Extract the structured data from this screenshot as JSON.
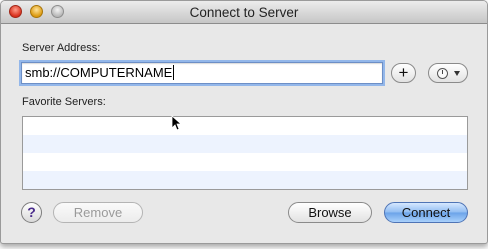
{
  "window": {
    "title": "Connect to Server"
  },
  "server_address": {
    "label": "Server Address:",
    "value": "smb://COMPUTERNAME"
  },
  "buttons": {
    "add": "+",
    "recent_icon": "clock-icon",
    "help": "?",
    "remove": "Remove",
    "browse": "Browse",
    "connect": "Connect"
  },
  "favorites": {
    "label": "Favorite Servers:",
    "items": []
  },
  "colors": {
    "focus_ring": "#93b7ea",
    "default_button": "#6aa2e8",
    "alt_row": "#edf3fe"
  }
}
